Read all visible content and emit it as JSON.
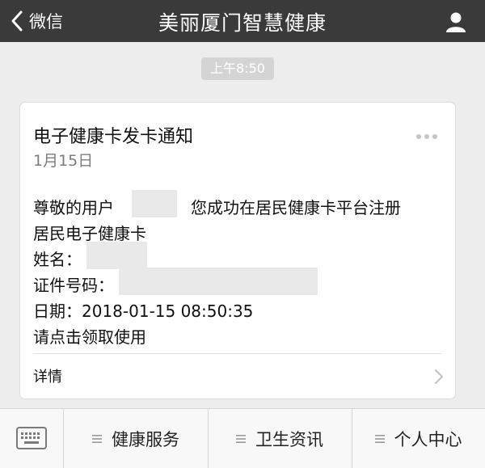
{
  "header": {
    "back_label": "微信",
    "title": "美丽厦门智慧健康"
  },
  "chat": {
    "time": "上午8:50"
  },
  "card": {
    "title": "电子健康卡发卡通知",
    "date": "1月15日",
    "greeting_prefix": "尊敬的用户",
    "greeting_suffix": "您成功在居民健康卡平台注册",
    "line2": "居民电子健康卡",
    "name_label": "姓名：",
    "id_label": "证件号码：",
    "date_line": "日期：2018-01-15 08:50:35",
    "action_line": "请点击领取使用",
    "detail_label": "详情"
  },
  "menu": {
    "items": [
      {
        "label": "健康服务"
      },
      {
        "label": "卫生资讯"
      },
      {
        "label": "个人中心"
      }
    ]
  }
}
